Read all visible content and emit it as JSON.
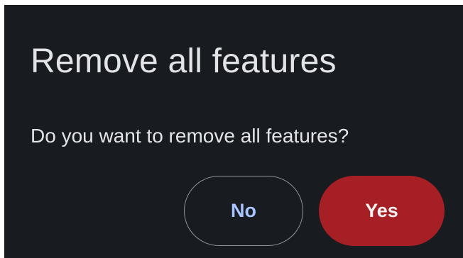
{
  "dialog": {
    "title": "Remove all features",
    "message": "Do you want to remove all features?",
    "buttons": {
      "no_label": "No",
      "yes_label": "Yes"
    }
  },
  "colors": {
    "background": "#181b20",
    "text": "#e2e4e8",
    "no_text": "#a9c5ff",
    "no_border": "#8e939c",
    "yes_background": "#a61f24"
  }
}
